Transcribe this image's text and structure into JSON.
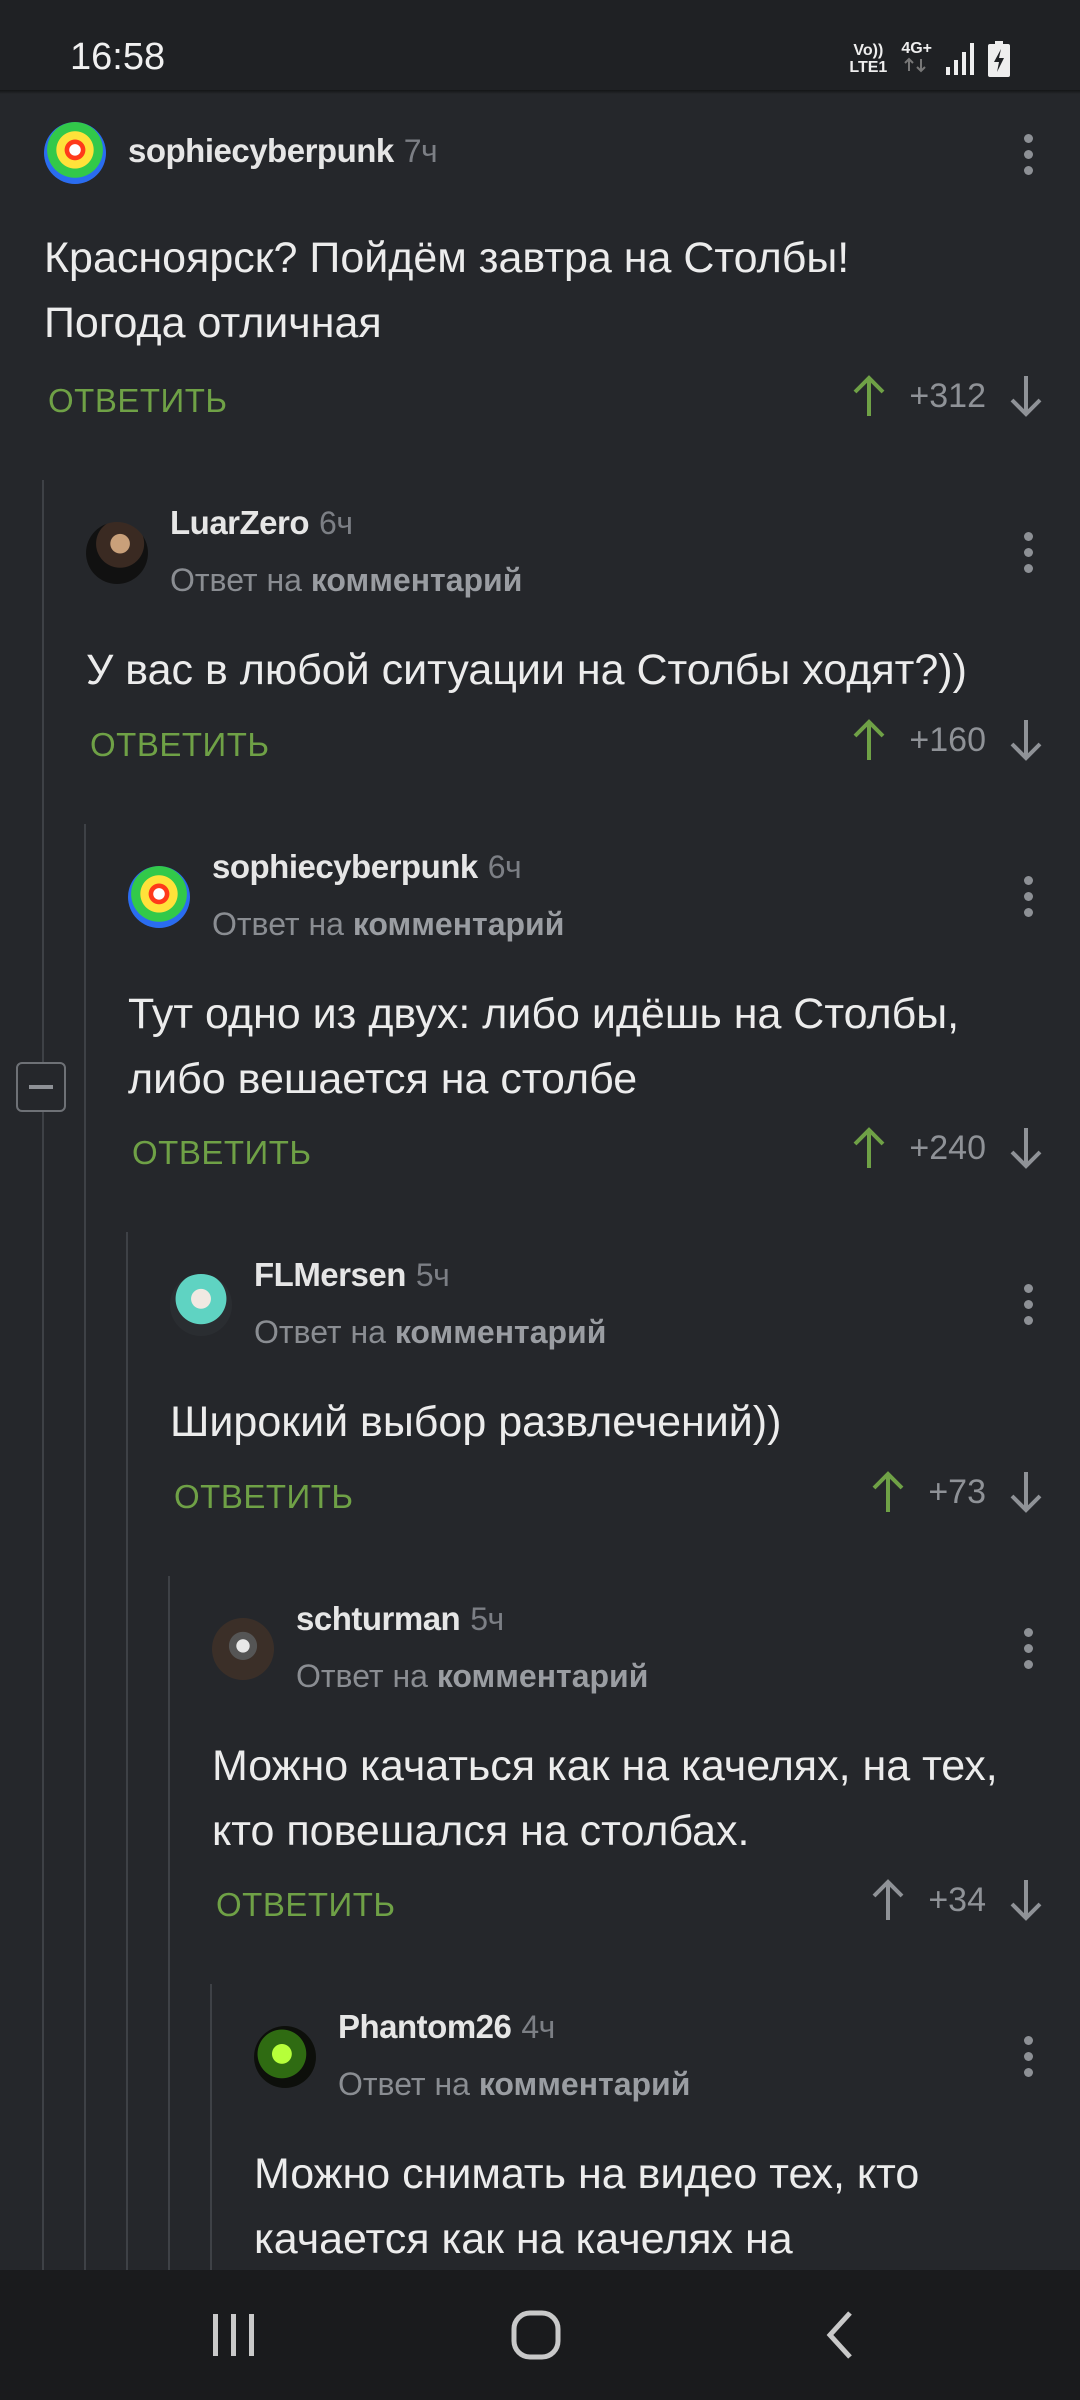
{
  "status": {
    "time": "16:58",
    "net_top": "Vo))",
    "net_bottom": "LTE1",
    "data_type": "4G+"
  },
  "comments": [
    {
      "user": "sophiecyberpunk",
      "time": "7ч",
      "reply_prefix": "",
      "reply_target": "",
      "text": "Красноярск? Пойдём завтра на Столбы! Погода отличная",
      "reply_label": "ОТВЕТИТЬ",
      "score": "+312",
      "avatar": "heatmap"
    },
    {
      "user": "LuarZero",
      "time": "6ч",
      "reply_prefix": "Ответ на",
      "reply_target": "комментарий",
      "text": "У вас в любой ситуации на Столбы ходят?))",
      "reply_label": "ОТВЕТИТЬ",
      "score": "+160",
      "avatar": "photo"
    },
    {
      "user": "sophiecyberpunk",
      "time": "6ч",
      "reply_prefix": "Ответ на",
      "reply_target": "комментарий",
      "text": "Тут одно из двух: либо идёшь на Столбы, либо вешается на столбе",
      "reply_label": "ОТВЕТИТЬ",
      "score": "+240",
      "avatar": "heatmap"
    },
    {
      "user": "FLMersen",
      "time": "5ч",
      "reply_prefix": "Ответ на",
      "reply_target": "комментарий",
      "text": "Широкий выбор развлечений))",
      "reply_label": "ОТВЕТИТЬ",
      "score": "+73",
      "avatar": "anime"
    },
    {
      "user": "schturman",
      "time": "5ч",
      "reply_prefix": "Ответ на",
      "reply_target": "комментарий",
      "text": "Можно качаться как на качелях, на тех, кто повешался на столбах.",
      "reply_label": "ОТВЕТИТЬ",
      "score": "+34",
      "avatar": "robot"
    },
    {
      "user": "Phantom26",
      "time": "4ч",
      "reply_prefix": "Ответ на",
      "reply_target": "комментарий",
      "text": "Можно снимать на видео тех, кто качается как на качелях на",
      "reply_label": "",
      "score": "",
      "avatar": "green"
    }
  ],
  "colors": {
    "background": "#25272b",
    "reply_green": "#6fa146",
    "upvote_active": "#6fa146",
    "muted": "#8f9297"
  }
}
